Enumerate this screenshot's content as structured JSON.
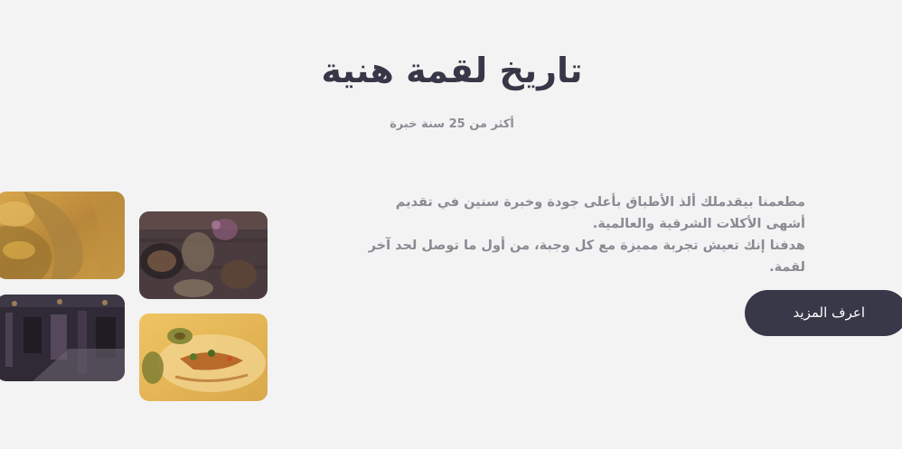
{
  "section": {
    "title": "تاريخ لقمة هنية",
    "subtitle": "أكثر من 25 سنة خبرة"
  },
  "description": {
    "line1": "مطعمنا بيقدملك ألذ الأطباق بأعلى جودة وخبرة سنين في تقديم أشهى الأكلات الشرقية والعالمية.",
    "line2": "هدفنا إنك تعيش تجربة مميزة مع كل وجبة، من أول ما توصل لحد آخر لقمة."
  },
  "cta": {
    "label": "اعرف المزيد"
  },
  "gallery": {
    "photos": [
      {
        "name": "grilled-bread-photo",
        "tint": "#c89a3c"
      },
      {
        "name": "table-spread-photo",
        "tint": "#4a3a3e"
      },
      {
        "name": "restaurant-interior-photo",
        "tint": "#3a3444"
      },
      {
        "name": "plated-dish-photo",
        "tint": "#e0b554"
      }
    ]
  },
  "colors": {
    "background": "#f3f3f4",
    "heading": "#383747",
    "muted_text": "#8b8a93",
    "button": "#393848",
    "button_text": "#ffffff"
  }
}
